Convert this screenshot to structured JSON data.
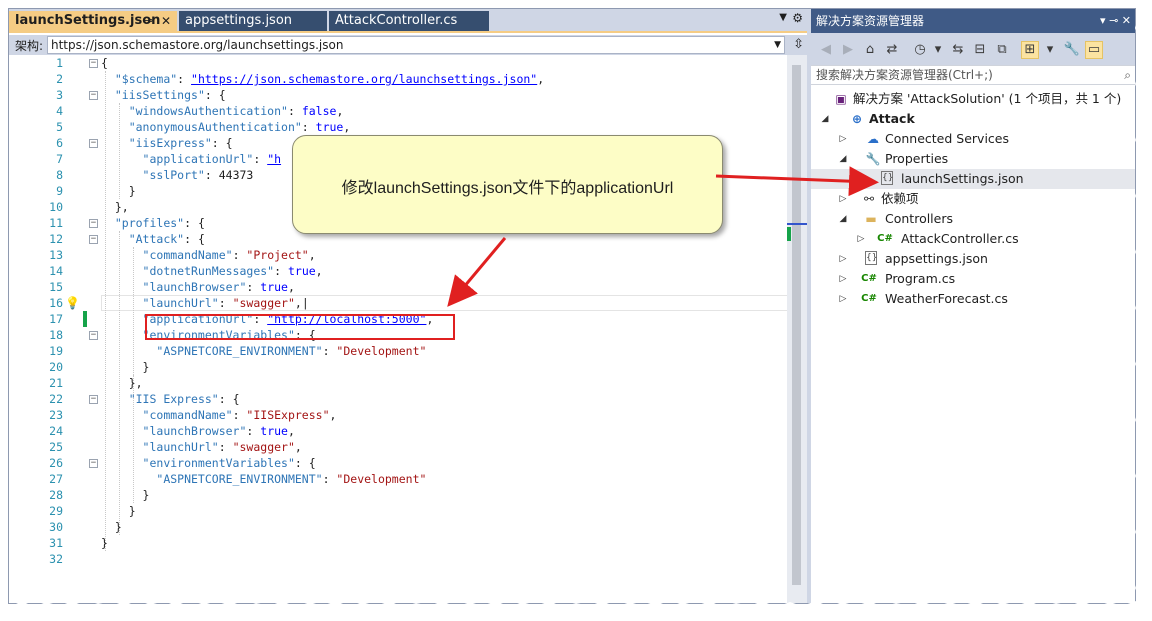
{
  "tabs": [
    {
      "label": "launchSettings.json",
      "active": true
    },
    {
      "label": "appsettings.json",
      "active": false
    },
    {
      "label": "AttackController.cs",
      "active": false
    }
  ],
  "schema": {
    "label": "架构:",
    "value": "https://json.schemastore.org/launchsettings.json"
  },
  "line_numbers": [
    "1",
    "2",
    "3",
    "4",
    "5",
    "6",
    "7",
    "8",
    "9",
    "10",
    "11",
    "12",
    "13",
    "14",
    "15",
    "16",
    "17",
    "18",
    "19",
    "20",
    "21",
    "22",
    "23",
    "24",
    "25",
    "26",
    "27",
    "28",
    "29",
    "30",
    "31",
    "32"
  ],
  "code": {
    "l1": "{",
    "l2_key": "\"$schema\"",
    "l2_url": "\"https://json.schemastore.org/launchsettings.json\"",
    "l3_key": "\"iisSettings\"",
    "l4_key": "\"windowsAuthentication\"",
    "l4_val": "false",
    "l5_key": "\"anonymousAuthentication\"",
    "l5_val": "true",
    "l6_key": "\"iisExpress\"",
    "l7_key": "\"applicationUrl\"",
    "l7_val": "\"h",
    "l8_key": "\"sslPort\"",
    "l8_val": "44373",
    "l11_key": "\"profiles\"",
    "l12_key": "\"Attack\"",
    "l13_key": "\"commandName\"",
    "l13_val": "\"Project\"",
    "l14_key": "\"dotnetRunMessages\"",
    "l14_val": "true",
    "l15_key": "\"launchBrowser\"",
    "l15_val": "true",
    "l16_key": "\"launchUrl\"",
    "l16_val": "\"swagger\"",
    "l17_key": "\"applicationUrl\"",
    "l17_url": "\"http://localhost:5000\"",
    "l18_key": "\"environmentVariables\"",
    "l19_key": "\"ASPNETCORE_ENVIRONMENT\"",
    "l19_val": "\"Development\"",
    "l22_key": "\"IIS Express\"",
    "l23_key": "\"commandName\"",
    "l23_val": "\"IISExpress\"",
    "l24_key": "\"launchBrowser\"",
    "l24_val": "true",
    "l25_key": "\"launchUrl\"",
    "l25_val": "\"swagger\"",
    "l26_key": "\"environmentVariables\"",
    "l27_key": "\"ASPNETCORE_ENVIRONMENT\"",
    "l27_val": "\"Development\""
  },
  "callout": {
    "text": "修改launchSettings.json文件下的applicationUrl"
  },
  "solution_explorer": {
    "title": "解决方案资源管理器",
    "search_placeholder": "搜索解决方案资源管理器(Ctrl+;)",
    "items": [
      {
        "label": "解决方案 'AttackSolution' (1 个项目，共 1 个)",
        "icon": "solution-icon"
      },
      {
        "label": "Attack",
        "icon": "web-project-icon"
      },
      {
        "label": "Connected Services",
        "icon": "connected-services-icon"
      },
      {
        "label": "Properties",
        "icon": "properties-icon"
      },
      {
        "label": "launchSettings.json",
        "icon": "json-file-icon"
      },
      {
        "label": "依赖项",
        "icon": "dependencies-icon"
      },
      {
        "label": "Controllers",
        "icon": "folder-icon"
      },
      {
        "label": "AttackController.cs",
        "icon": "csharp-file-icon"
      },
      {
        "label": "appsettings.json",
        "icon": "json-file-icon"
      },
      {
        "label": "Program.cs",
        "icon": "csharp-file-icon"
      },
      {
        "label": "WeatherForecast.cs",
        "icon": "csharp-file-icon"
      }
    ]
  },
  "colors": {
    "active_tab": "#f5cc84",
    "inactive_tab": "#364e6f",
    "se_title": "#3f5a86",
    "highlight_box": "#e02020",
    "callout_bg": "#fdfdc6",
    "json_key": "#2e75b6",
    "json_string": "#a31515",
    "json_literal": "#0000ff"
  }
}
